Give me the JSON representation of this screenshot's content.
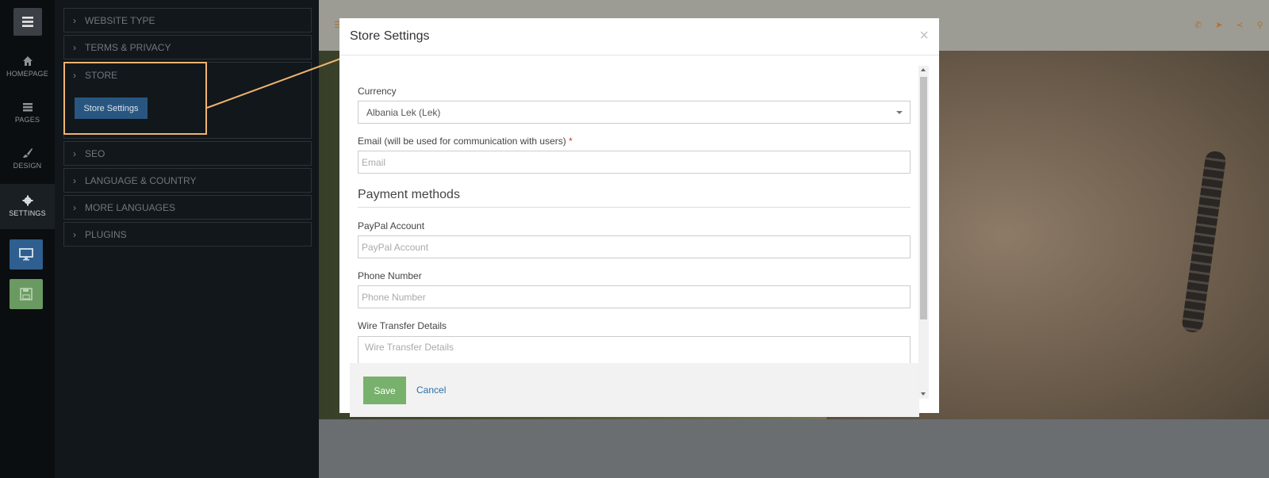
{
  "rail": {
    "items": [
      {
        "label": "HOMEPAGE",
        "icon": "home-icon"
      },
      {
        "label": "PAGES",
        "icon": "pages-icon"
      },
      {
        "label": "DESIGN",
        "icon": "brush-icon"
      },
      {
        "label": "SETTINGS",
        "icon": "gear-icon"
      }
    ],
    "buttons": [
      {
        "icon": "desktop-icon",
        "color": "#2e5f8f"
      },
      {
        "icon": "save-icon",
        "color": "#6a9a61"
      }
    ]
  },
  "panel": {
    "sections": [
      "WEBSITE TYPE",
      "TERMS & PRIVACY",
      "STORE",
      "SEO",
      "LANGUAGE & COUNTRY",
      "MORE LANGUAGES",
      "PLUGINS"
    ],
    "store_button": "Store Settings"
  },
  "modal": {
    "title": "Store Settings",
    "close": "×",
    "currency_label": "Currency",
    "currency_value": "Albania Lek (Lek)",
    "email_label": "Email (will be used for communication with users)",
    "required_mark": "*",
    "email_placeholder": "Email",
    "payment_title": "Payment methods",
    "paypal_label": "PayPal Account",
    "paypal_placeholder": "PayPal Account",
    "phone_label": "Phone Number",
    "phone_placeholder": "Phone Number",
    "wire_label": "Wire Transfer Details",
    "wire_placeholder": "Wire Transfer Details",
    "save": "Save",
    "cancel": "Cancel"
  },
  "colors": {
    "accent_highlight": "#efb46f",
    "primary": "#295680",
    "save": "#77b16c",
    "link": "#2a6fa8"
  }
}
